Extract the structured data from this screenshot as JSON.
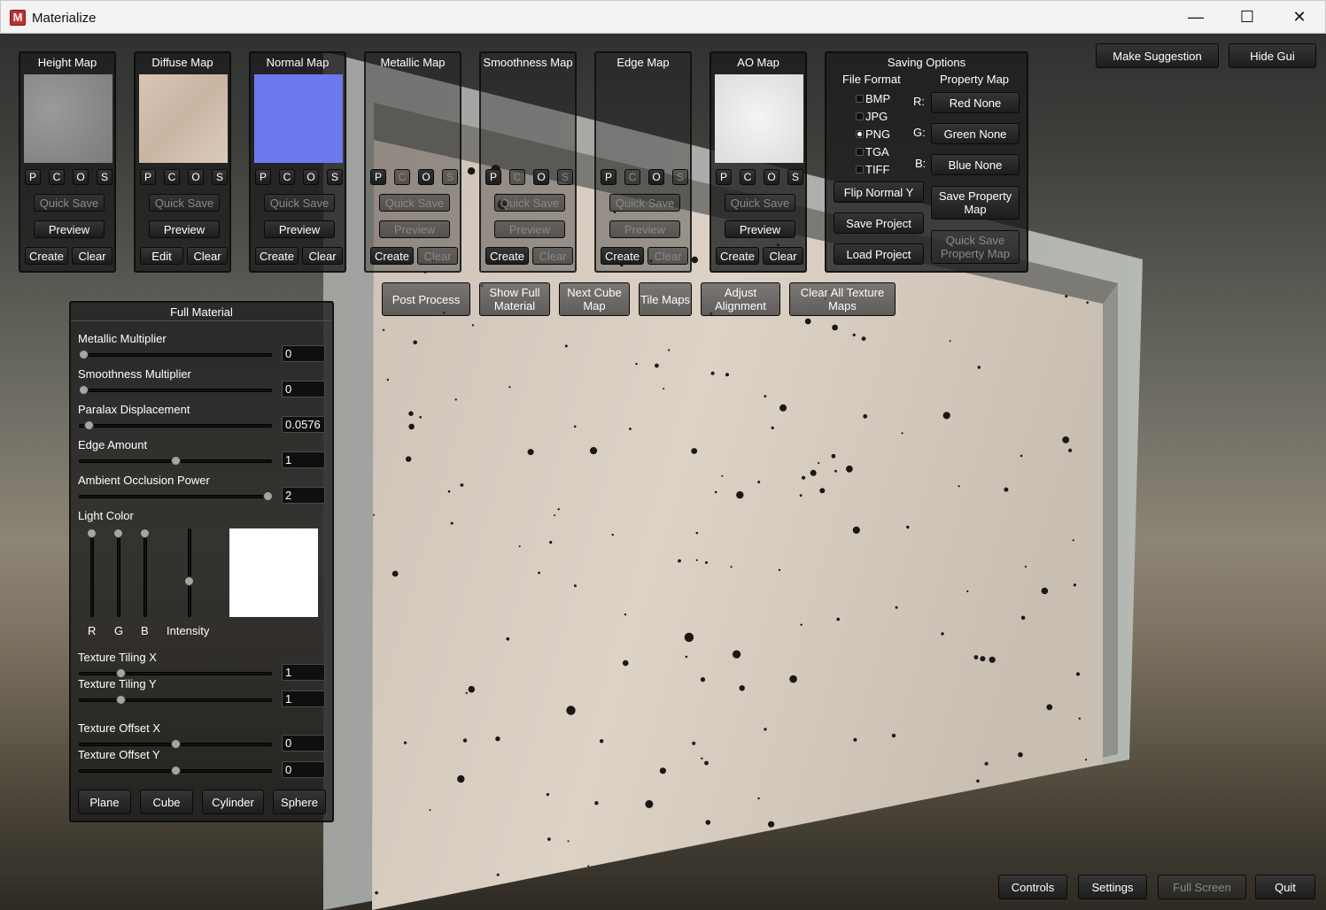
{
  "window": {
    "title": "Materialize",
    "app_icon_letter": "M",
    "minimize_icon": "—",
    "maximize_icon": "☐",
    "close_icon": "✕"
  },
  "map_panels": [
    {
      "title": "Height Map",
      "quick_save": "Quick Save",
      "preview": "Preview",
      "create": "Create",
      "clear": "Clear",
      "active": true
    },
    {
      "title": "Diffuse Map",
      "quick_save": "Quick Save",
      "preview": "Preview",
      "create": "Edit",
      "clear": "Clear",
      "active": true
    },
    {
      "title": "Normal Map",
      "quick_save": "Quick Save",
      "preview": "Preview",
      "create": "Create",
      "clear": "Clear",
      "active": true
    },
    {
      "title": "Metallic Map",
      "quick_save": "Quick Save",
      "preview": "Preview",
      "create": "Create",
      "clear": "Clear",
      "active": false
    },
    {
      "title": "Smoothness Map",
      "quick_save": "Quick Save",
      "preview": "Preview",
      "create": "Create",
      "clear": "Clear",
      "active": false
    },
    {
      "title": "Edge Map",
      "quick_save": "Quick Save",
      "preview": "Preview",
      "create": "Create",
      "clear": "Clear",
      "active": false
    },
    {
      "title": "AO Map",
      "quick_save": "Quick Save",
      "preview": "Preview",
      "create": "Create",
      "clear": "Clear",
      "active": true,
      "preview_enabled": true
    }
  ],
  "pcos": [
    "P",
    "C",
    "O",
    "S"
  ],
  "saving": {
    "title": "Saving Options",
    "file_format_label": "File Format",
    "property_map_label": "Property Map",
    "formats": [
      "BMP",
      "JPG",
      "PNG",
      "TGA",
      "TIFF"
    ],
    "selected_format": "PNG",
    "channels": [
      {
        "label": "R:",
        "value": "Red None"
      },
      {
        "label": "G:",
        "value": "Green None"
      },
      {
        "label": "B:",
        "value": "Blue None"
      }
    ],
    "flip_normal": "Flip Normal Y",
    "save_project": "Save Project",
    "load_project": "Load Project",
    "save_property_map": "Save Property Map",
    "quick_save_property_map": "Quick Save Property Map"
  },
  "top_right": {
    "suggestion": "Make Suggestion",
    "hide_gui": "Hide Gui"
  },
  "toolbar": [
    "Post Process",
    "Show Full Material",
    "Next Cube Map",
    "Tile Maps",
    "Adjust Alignment",
    "Clear All Texture Maps"
  ],
  "full_material": {
    "title": "Full Material",
    "sliders_top": [
      {
        "label": "Metallic Multiplier",
        "value": "0",
        "fraction": 0.0
      },
      {
        "label": "Smoothness Multiplier",
        "value": "0",
        "fraction": 0.0
      },
      {
        "label": "Paralax Displacement",
        "value": "0.0576",
        "fraction": 0.03
      },
      {
        "label": "Edge Amount",
        "value": "1",
        "fraction": 0.5
      },
      {
        "label": "Ambient Occlusion Power",
        "value": "2",
        "fraction": 1.0
      }
    ],
    "light_color": {
      "label": "Light Color",
      "channels": [
        "R",
        "G",
        "B"
      ],
      "intensity_label": "Intensity",
      "swatch": "#ffffff",
      "r": 1.0,
      "g": 1.0,
      "b": 1.0,
      "intensity": 0.4
    },
    "sliders_bottom": [
      {
        "label": "Texture Tiling X",
        "value": "1",
        "fraction": 0.2
      },
      {
        "label": "Texture Tiling Y",
        "value": "1",
        "fraction": 0.2
      },
      {
        "label": "Texture Offset X",
        "value": "0",
        "fraction": 0.5
      },
      {
        "label": "Texture Offset Y",
        "value": "0",
        "fraction": 0.5
      }
    ],
    "shapes": [
      "Plane",
      "Cube",
      "Cylinder",
      "Sphere"
    ]
  },
  "bottom_bar": [
    {
      "label": "Controls",
      "enabled": true
    },
    {
      "label": "Settings",
      "enabled": true
    },
    {
      "label": "Full Screen",
      "enabled": false
    },
    {
      "label": "Quit",
      "enabled": true
    }
  ]
}
